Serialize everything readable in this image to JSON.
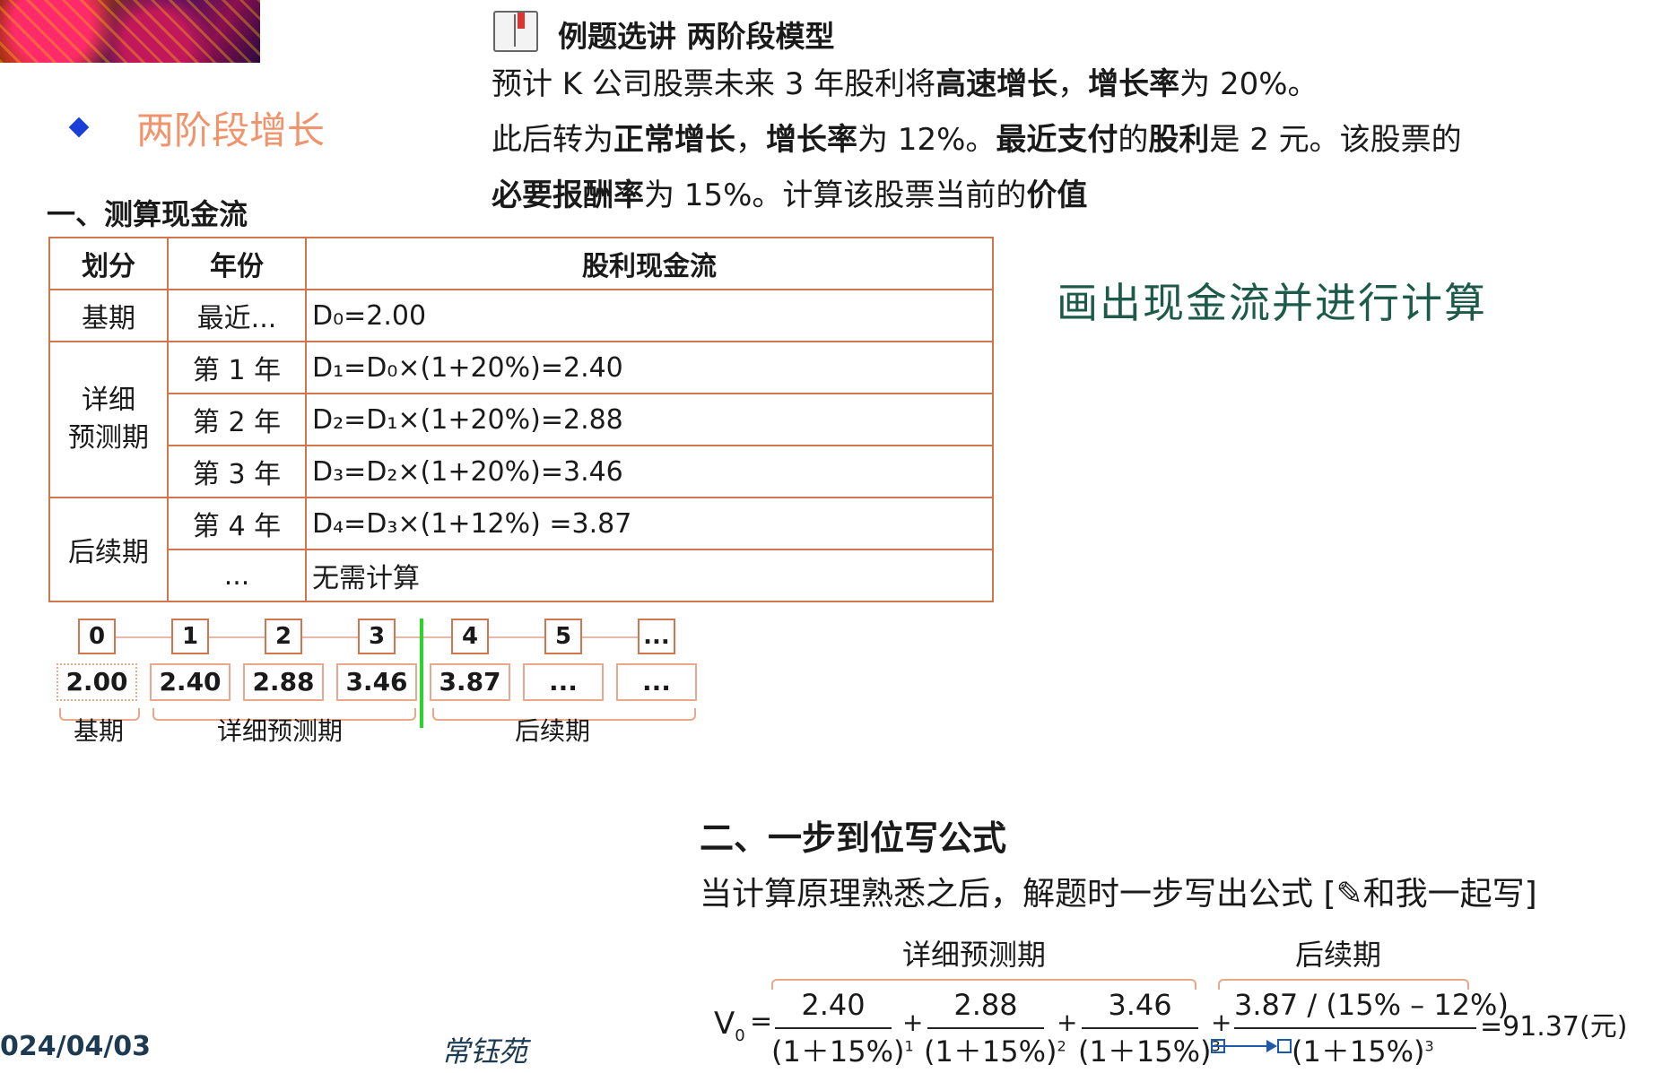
{
  "left": {
    "title": "两阶段增长",
    "section1": "一、测算现金流"
  },
  "example": {
    "title": "例题选讲  两阶段模型",
    "lines": [
      [
        "预计 K 公司股票未来 3 年股利将",
        "高速增长",
        "，",
        "增长率",
        "为 20%。"
      ],
      [
        "此后转为",
        "正常增长",
        "，",
        "增长率",
        "为 12%。",
        "最近支付",
        "的",
        "股利",
        "是 2 元。该股票的"
      ],
      [
        "必要报酬率",
        "为 15%。计算该股票当前的",
        "价值"
      ]
    ]
  },
  "side_note": "画出现金流并进行计算",
  "table": {
    "headers": [
      "划分",
      "年份",
      "股利现金流"
    ],
    "rows": [
      {
        "phase": "基期",
        "year": "最近...",
        "cf": "D₀=2.00"
      },
      {
        "phase": "详细预测期",
        "year": "第 1 年",
        "cf": "D₁=D₀×(1+20%)=2.40"
      },
      {
        "phase": "",
        "year": "第 2 年",
        "cf": "D₂=D₁×(1+20%)=2.88"
      },
      {
        "phase": "",
        "year": "第 3 年",
        "cf": "D₃=D₂×(1+20%)=3.46"
      },
      {
        "phase": "后续期",
        "year": "第 4 年",
        "cf": "D₄=D₃×(1+12%) =3.87"
      },
      {
        "phase": "",
        "year": "...",
        "cf": "无需计算"
      }
    ],
    "phase2_line1": "详细",
    "phase2_line2": "预测期"
  },
  "timeline": {
    "periods": [
      "0",
      "1",
      "2",
      "3",
      "4",
      "5",
      "..."
    ],
    "values": [
      "2.00",
      "2.40",
      "2.88",
      "3.46",
      "3.87",
      "...",
      "..."
    ],
    "labels": [
      "基期",
      "详细预测期",
      "后续期"
    ]
  },
  "section2": {
    "title": "二、一步到位写公式",
    "desc": "当计算原理熟悉之后，解题时一步写出公式 [✎和我一起写]",
    "brace_labels": [
      "详细预测期",
      "后续期"
    ],
    "v0": "V",
    "v0_sub": "0",
    "eq": "=",
    "plus": "+",
    "numerators": [
      "2.40",
      "2.88",
      "3.46",
      "3.87 / (15% – 12%)"
    ],
    "denominators": [
      "(1＋15%)",
      "(1＋15%)",
      "(1＋15%)",
      "(1＋15%)"
    ],
    "exponents": [
      "1",
      "2",
      "3",
      "3"
    ],
    "result": "=91.37(元)"
  },
  "footer": {
    "date": "024/04/03",
    "author": "常钰苑"
  }
}
